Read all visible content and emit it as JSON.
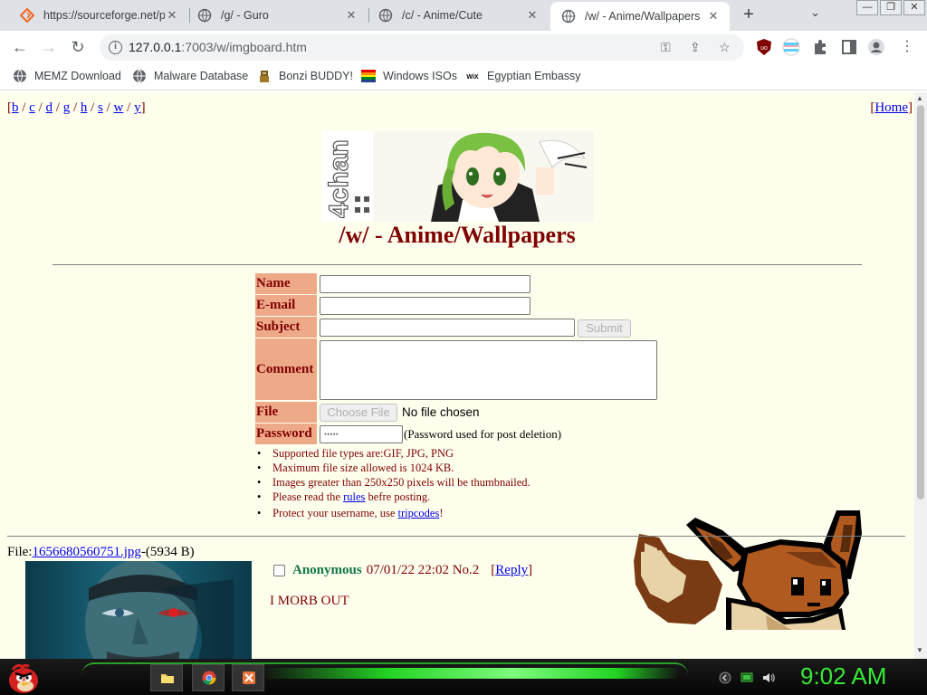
{
  "browser": {
    "tabs": [
      {
        "title": "https://sourceforge.net/p",
        "icon": "sourceforge-icon",
        "active": false
      },
      {
        "title": "/g/ - Guro",
        "icon": "globe-icon",
        "active": false
      },
      {
        "title": "/c/ - Anime/Cute",
        "icon": "globe-icon",
        "active": false
      },
      {
        "title": "/w/ - Anime/Wallpapers",
        "icon": "globe-icon",
        "active": true
      }
    ],
    "url_host": "127.0.0.1",
    "url_path": ":7003/w/imgboard.htm",
    "bookmarks": [
      {
        "label": "MEMZ Download",
        "icon": "globe-icon"
      },
      {
        "label": "Malware Database",
        "icon": "globe-icon"
      },
      {
        "label": "Bonzi BUDDY!",
        "icon": "bonzi-icon"
      },
      {
        "label": "Windows ISOs",
        "icon": "windows-flag-icon"
      },
      {
        "label": "Egyptian Embassy",
        "icon": "wix-icon"
      }
    ]
  },
  "page": {
    "boards": [
      "b",
      "c",
      "d",
      "g",
      "h",
      "s",
      "w",
      "y"
    ],
    "home_label": "Home",
    "banner_text": "4chan",
    "board_title": "/w/ - Anime/Wallpapers",
    "form": {
      "name_label": "Name",
      "email_label": "E-mail",
      "subject_label": "Subject",
      "submit_label": "Submit",
      "comment_label": "Comment",
      "file_label": "File",
      "choose_file_label": "Choose File",
      "no_file_text": "No file chosen",
      "password_label": "Password",
      "password_value": "•••••",
      "password_note": "(Password used for post deletion)"
    },
    "rules": {
      "line1": "Supported file types are:GIF, JPG, PNG",
      "line2": "Maximum file size allowed is 1024 KB.",
      "line3": "Images greater than 250x250 pixels will be thumbnailed.",
      "line4_pre": "Please read the ",
      "line4_link": "rules",
      "line4_post": " befre posting.",
      "line5_pre": " Protect your username, use ",
      "line5_link": "tripcodes",
      "line5_post": "!"
    },
    "post": {
      "file_prefix": "File:",
      "file_name": "1656680560751.jpg",
      "file_size": "-(5934 B)",
      "author": "Anonymous",
      "datetime": "07/01/22 22:02 No.2",
      "reply_label": "Reply",
      "comment": "I MORB OUT"
    }
  },
  "taskbar": {
    "clock": "9:02 AM",
    "apps": [
      "folder-icon",
      "chrome-icon",
      "app-icon"
    ]
  },
  "colors": {
    "page_bg": "#ffffee",
    "label_bg": "#eeaa88",
    "maroon": "#800000",
    "name_green": "#117743",
    "clock_green": "#38e838"
  }
}
